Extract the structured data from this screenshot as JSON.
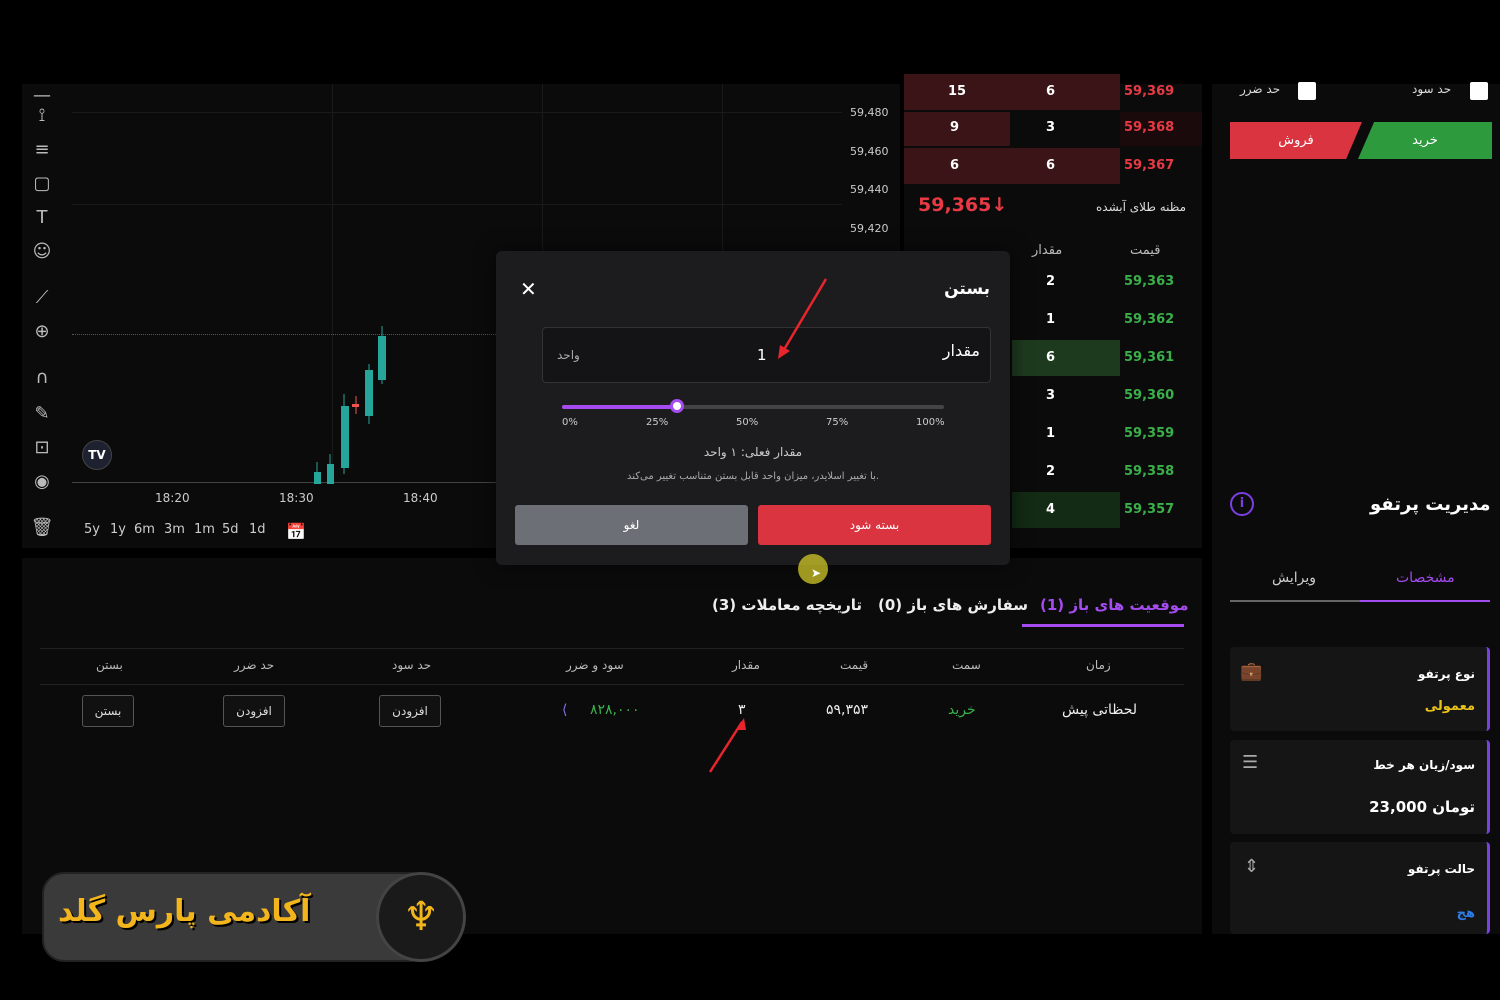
{
  "chart": {
    "price_ticks": [
      "59,480",
      "59,460",
      "59,440",
      "59,420"
    ],
    "time_ticks": [
      "18:20",
      "18:30",
      "18:40"
    ],
    "ranges": [
      "5y",
      "1y",
      "6m",
      "3m",
      "1m",
      "5d",
      "1d"
    ],
    "logo_text": "TV"
  },
  "orderbook": {
    "sell_rows": [
      {
        "count": "15",
        "qty": "6",
        "price": "59,369"
      },
      {
        "count": "9",
        "qty": "3",
        "price": "59,368"
      },
      {
        "count": "6",
        "qty": "6",
        "price": "59,367"
      }
    ],
    "last_price": "59,365",
    "last_arrow": "↓",
    "instrument": "مظنه طلای آبشده",
    "col_qty": "مقدار",
    "col_price": "قیمت",
    "buy_rows": [
      {
        "qty": "2",
        "price": "59,363"
      },
      {
        "qty": "1",
        "price": "59,362"
      },
      {
        "qty": "6",
        "price": "59,361"
      },
      {
        "qty": "3",
        "price": "59,360"
      },
      {
        "qty": "1",
        "price": "59,359"
      },
      {
        "qty": "2",
        "price": "59,358"
      },
      {
        "qty": "4",
        "price": "59,357"
      }
    ]
  },
  "right": {
    "take_profit": "حد سود",
    "stop_loss": "حد ضرر",
    "buy": "خرید",
    "sell": "فروش",
    "title": "مدیریت پرتفو",
    "tab_specs": "مشخصات",
    "tab_edit": "ویرایش",
    "cards": [
      {
        "label": "نوع پرتفو",
        "value": "معمولی"
      },
      {
        "label": "سود/زیان هر خط",
        "value": "23,000 تومان"
      },
      {
        "label": "حالت پرتفو",
        "value": "هج"
      }
    ]
  },
  "bottom": {
    "tabs": [
      "موقعیت های باز (1)",
      "سفارش های باز (0)",
      "تاریخچه معاملات (3)"
    ],
    "headers": [
      "زمان",
      "سمت",
      "قیمت",
      "مقدار",
      "سود و ضرر",
      "حد سود",
      "حد ضرر",
      "بستن"
    ],
    "row": {
      "time": "لحظاتی پیش",
      "side": "خرید",
      "price": "۵۹,۳۵۳",
      "qty": "۳",
      "pnl": "۸۲۸,۰۰۰",
      "tp_btn": "افزودن",
      "sl_btn": "افزودن",
      "close_btn": "بستن"
    }
  },
  "modal": {
    "title": "بستن",
    "close_icon": "✕",
    "field_label": "مقدار",
    "field_value": "1",
    "field_unit": "واحد",
    "slider_value": 0.3,
    "slider_ticks": [
      "0%",
      "25%",
      "50%",
      "75%",
      "100%"
    ],
    "current_amount": "مقدار فعلی: ۱ واحد",
    "hint": "با تغییر اسلایدر، میزان واحد قابل بستن متناسب تغییر می‌کند.",
    "cancel": "لغو",
    "confirm": "بسته شود"
  },
  "logo": {
    "text": "آکادمی پارس گلد"
  },
  "colors": {
    "red": "#e83a45",
    "green": "#3bb04a",
    "purple": "#a44cf0",
    "sell_btn": "#d9343f",
    "buy_btn": "#2e9a3e"
  }
}
